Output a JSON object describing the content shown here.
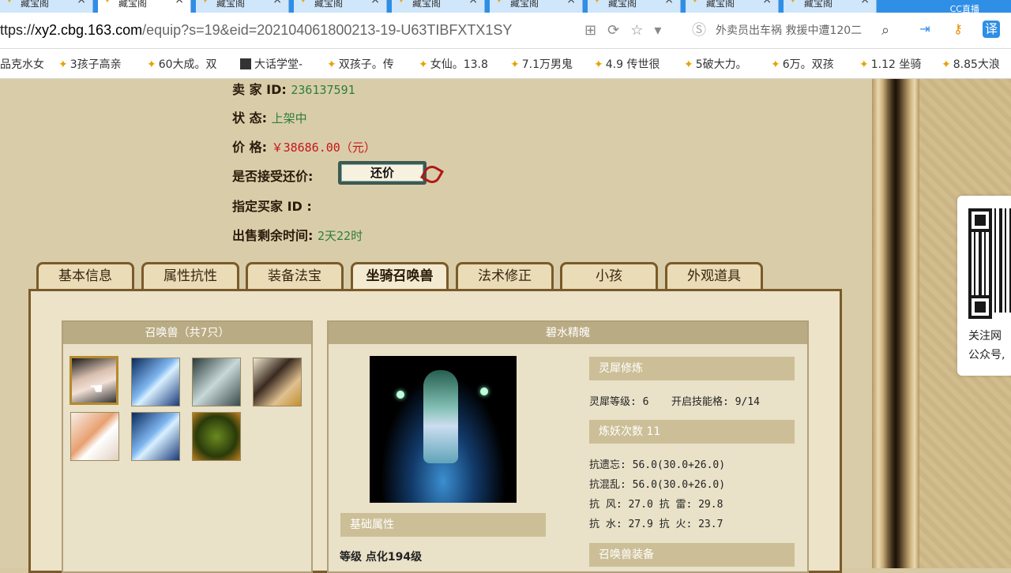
{
  "browser": {
    "tabs": [
      {
        "label": "藏宝阁"
      },
      {
        "label": "藏宝阁"
      },
      {
        "label": "藏宝阁"
      },
      {
        "label": "藏宝阁"
      },
      {
        "label": "藏宝阁"
      },
      {
        "label": "藏宝阁"
      },
      {
        "label": "藏宝阁"
      },
      {
        "label": "藏宝阁"
      },
      {
        "label": "藏宝阁"
      }
    ],
    "corner_text": "CC直播",
    "url_scheme": "ttps://",
    "url_host": "xy2.cbg.163.com",
    "url_path": "/equip?s=19&eid=202104061800213-19-U63TIBFXTX1SY",
    "search_text": "外卖员出车祸 救援中遭120二",
    "bookmarks": [
      "品克水女",
      "3孩子高亲",
      "60大成。双",
      "大话学堂-",
      "双孩子。传",
      "女仙。13.8",
      "7.1万男鬼",
      "4.9 传世很",
      "5破大力。",
      "6万。双孩",
      "1.12 坐骑",
      "8.85大浪"
    ]
  },
  "listing": {
    "seller_label": "卖  家    ID:",
    "seller_id": "236137591",
    "status_label": "状        态:",
    "status_value": "上架中",
    "price_label": "价        格:",
    "price_value": "￥38686.00（元）",
    "counter_label": "是否接受还价:",
    "counter_button": "还价",
    "buyer_label": "指定买家 ID :",
    "time_label": "出售剩余时间:",
    "time_value": "2天22时"
  },
  "tabs": [
    "基本信息",
    "属性抗性",
    "装备法宝",
    "坐骑召唤兽",
    "法术修正",
    "小孩",
    "外观道具"
  ],
  "active_tab": "坐骑召唤兽",
  "pets_panel": {
    "title": "召唤兽（共7只）"
  },
  "pet_detail": {
    "name": "碧水精魄",
    "lingxi_title": "灵犀修炼",
    "lingxi_level_label": "灵犀等级: 6",
    "skill_slots_label": "开启技能格: 9/14",
    "refine_title": "炼妖次数 11",
    "stats": [
      "抗遗忘: 56.0(30.0+26.0)",
      "抗混乱: 56.0(30.0+26.0)",
      "抗  风: 27.0 抗  雷: 29.8",
      "抗  水: 27.9 抗  火: 23.7"
    ],
    "basic_title": "基础属性",
    "level_text": "等级 点化194级",
    "equip_title": "召唤兽装备"
  },
  "qr": {
    "line1": "关注网",
    "line2": "公众号,"
  }
}
